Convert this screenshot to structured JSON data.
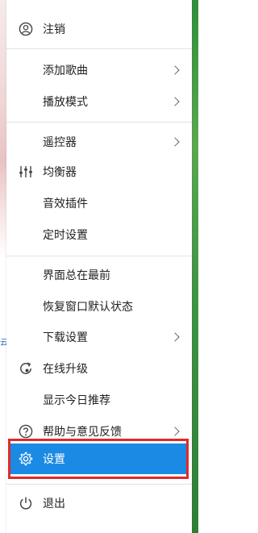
{
  "menu": {
    "items": [
      {
        "label": "注销",
        "icon": "user-circle-icon",
        "submenu": false
      },
      {
        "label": "添加歌曲",
        "icon": "",
        "submenu": true
      },
      {
        "label": "播放模式",
        "icon": "",
        "submenu": true
      },
      {
        "label": "遥控器",
        "icon": "",
        "submenu": true
      },
      {
        "label": "均衡器",
        "icon": "equalizer-icon",
        "submenu": false
      },
      {
        "label": "音效插件",
        "icon": "",
        "submenu": false
      },
      {
        "label": "定时设置",
        "icon": "",
        "submenu": false
      },
      {
        "label": "界面总在最前",
        "icon": "",
        "submenu": false
      },
      {
        "label": "恢复窗口默认状态",
        "icon": "",
        "submenu": false
      },
      {
        "label": "下载设置",
        "icon": "",
        "submenu": true
      },
      {
        "label": "在线升级",
        "icon": "update-icon",
        "submenu": false
      },
      {
        "label": "显示今日推荐",
        "icon": "",
        "submenu": false
      },
      {
        "label": "帮助与意见反馈",
        "icon": "help-icon",
        "submenu": true
      },
      {
        "label": "设置",
        "icon": "gear-icon",
        "submenu": false,
        "selected": true
      },
      {
        "label": "退出",
        "icon": "power-icon",
        "submenu": false
      }
    ]
  },
  "background": {
    "left_fragment": "云"
  },
  "colors": {
    "selected_bg": "#1b8ae4",
    "highlight_frame": "#e02a2a",
    "divider": "#e3e3e3"
  }
}
